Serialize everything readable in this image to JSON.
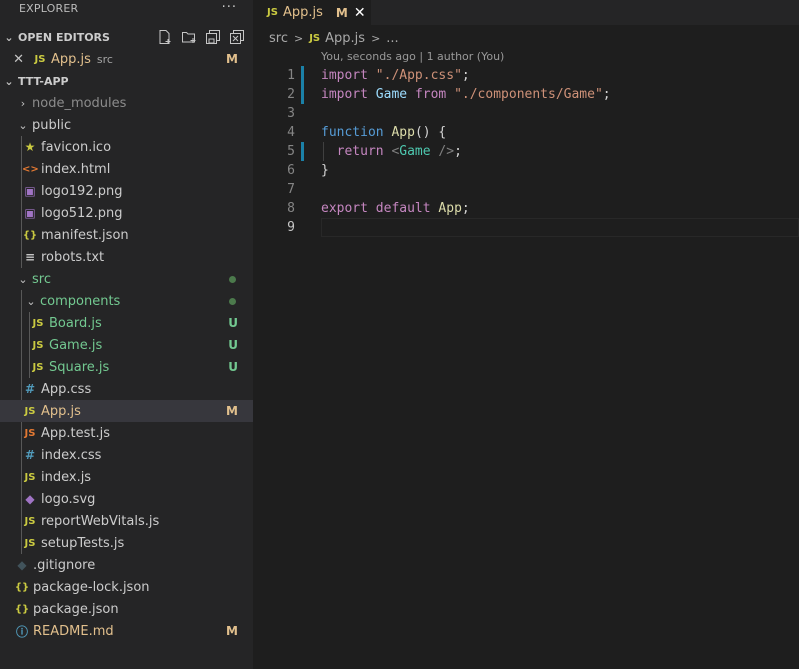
{
  "explorer": {
    "title": "EXPLORER",
    "more": "···",
    "open_editors": {
      "title": "OPEN EDITORS",
      "items": [
        {
          "close": "✕",
          "icon": "JS",
          "name": "App.js",
          "desc": "src",
          "status": "M"
        }
      ]
    },
    "project": {
      "title": "TTT-APP",
      "tree": [
        {
          "name": "node_modules",
          "type": "folder",
          "expanded": false
        },
        {
          "name": "public",
          "type": "folder",
          "expanded": true
        },
        {
          "name": "favicon.ico",
          "icon": "★"
        },
        {
          "name": "index.html",
          "icon": "<>"
        },
        {
          "name": "logo192.png",
          "icon": "▣"
        },
        {
          "name": "logo512.png",
          "icon": "▣"
        },
        {
          "name": "manifest.json",
          "icon": "{}"
        },
        {
          "name": "robots.txt",
          "icon": "≡"
        },
        {
          "name": "src",
          "type": "folder",
          "expanded": true
        },
        {
          "name": "components",
          "type": "folder",
          "expanded": true
        },
        {
          "name": "Board.js",
          "icon": "JS",
          "status": "U"
        },
        {
          "name": "Game.js",
          "icon": "JS",
          "status": "U"
        },
        {
          "name": "Square.js",
          "icon": "JS",
          "status": "U"
        },
        {
          "name": "App.css",
          "icon": "#"
        },
        {
          "name": "App.js",
          "icon": "JS",
          "status": "M"
        },
        {
          "name": "App.test.js",
          "icon": "JS"
        },
        {
          "name": "index.css",
          "icon": "#"
        },
        {
          "name": "index.js",
          "icon": "JS"
        },
        {
          "name": "logo.svg",
          "icon": "◆"
        },
        {
          "name": "reportWebVitals.js",
          "icon": "JS"
        },
        {
          "name": "setupTests.js",
          "icon": "JS"
        },
        {
          "name": ".gitignore",
          "icon": "◆"
        },
        {
          "name": "package-lock.json",
          "icon": "{}"
        },
        {
          "name": "package.json",
          "icon": "{}"
        },
        {
          "name": "README.md",
          "icon": "ⓘ",
          "status": "M"
        }
      ]
    }
  },
  "editor": {
    "tab": {
      "icon": "JS",
      "name": "App.js",
      "status": "M",
      "close": "✕"
    },
    "breadcrumb": {
      "folder": "src",
      "sep": ">",
      "icon": "JS",
      "file": "App.js",
      "sep2": ">",
      "symbol": "..."
    },
    "codelens": "You, seconds ago | 1 author (You)",
    "lines": [
      {
        "n": "1",
        "tokens": [
          [
            "kw",
            "import"
          ],
          [
            "",
            " "
          ],
          [
            "str",
            "\"./App.css\""
          ],
          [
            "",
            ";"
          ]
        ]
      },
      {
        "n": "2",
        "tokens": [
          [
            "kw",
            "import"
          ],
          [
            "",
            " "
          ],
          [
            "var",
            "Game"
          ],
          [
            "",
            " "
          ],
          [
            "kw",
            "from"
          ],
          [
            "",
            " "
          ],
          [
            "str",
            "\"./components/Game\""
          ],
          [
            "",
            ";"
          ]
        ]
      },
      {
        "n": "3",
        "tokens": []
      },
      {
        "n": "4",
        "tokens": [
          [
            "kw2",
            "function"
          ],
          [
            "",
            " "
          ],
          [
            "fn",
            "App"
          ],
          [
            "",
            "() {"
          ]
        ]
      },
      {
        "n": "5",
        "tokens": [
          [
            "",
            "  "
          ],
          [
            "kw",
            "return"
          ],
          [
            "",
            " "
          ],
          [
            "punct",
            "<"
          ],
          [
            "tag",
            "Game"
          ],
          [
            "",
            " "
          ],
          [
            "punct",
            "/>"
          ],
          [
            "",
            ";"
          ]
        ]
      },
      {
        "n": "6",
        "tokens": [
          [
            "",
            "}"
          ]
        ]
      },
      {
        "n": "7",
        "tokens": []
      },
      {
        "n": "8",
        "tokens": [
          [
            "kw",
            "export"
          ],
          [
            "",
            " "
          ],
          [
            "kw",
            "default"
          ],
          [
            "",
            " "
          ],
          [
            "fn",
            "App"
          ],
          [
            "",
            ";"
          ]
        ]
      },
      {
        "n": "9",
        "tokens": []
      }
    ]
  },
  "colors": {
    "sidebar_bg": "#252526",
    "editor_bg": "#1e1e1e",
    "modified": "#e2c08d",
    "untracked": "#73c991",
    "js_icon": "#cbcb41"
  }
}
